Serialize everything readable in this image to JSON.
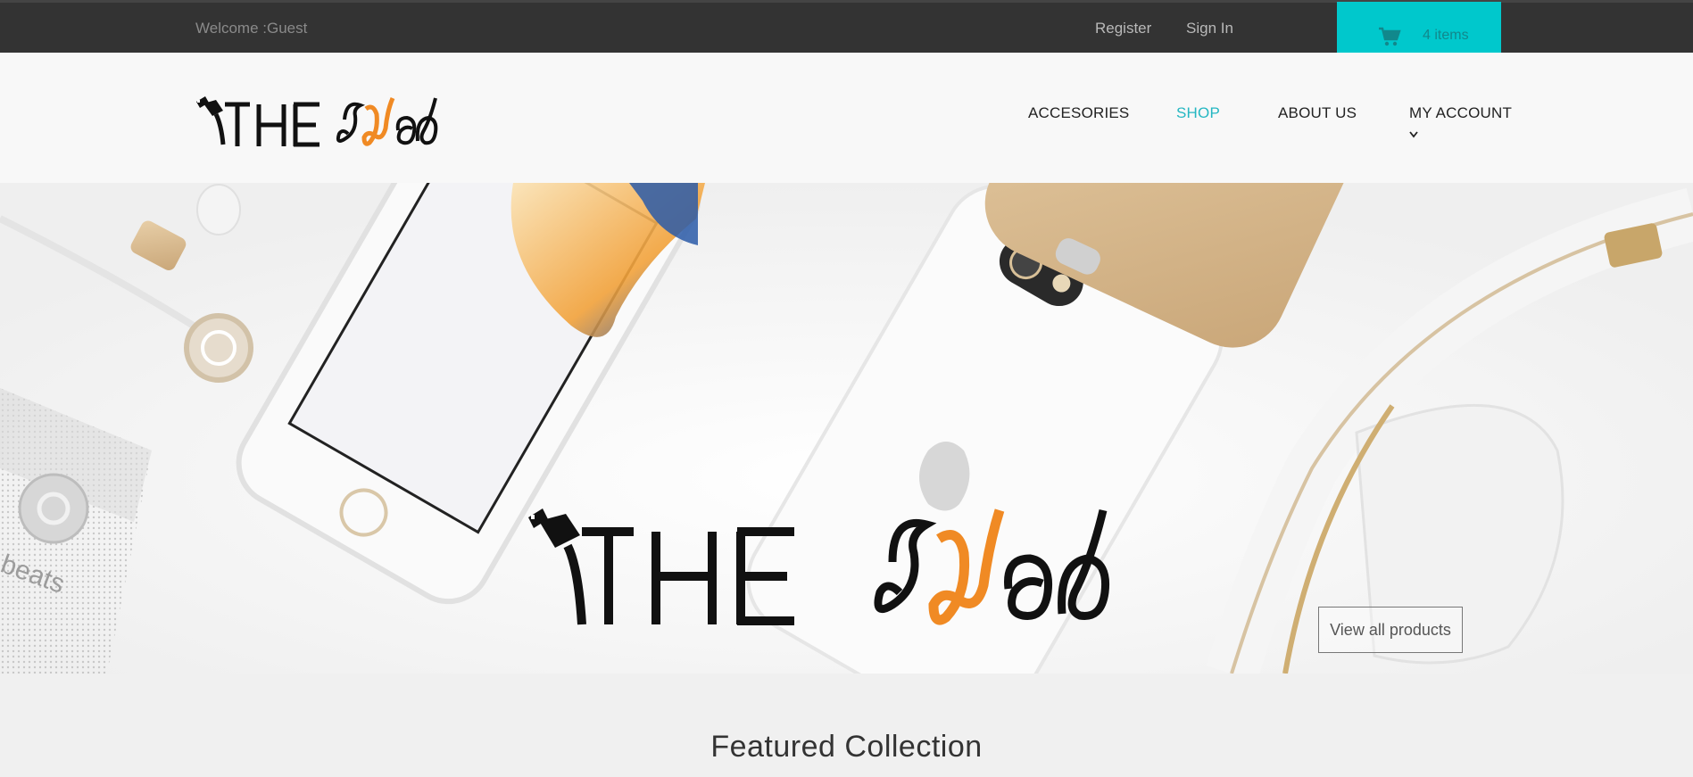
{
  "topbar": {
    "welcome": "Welcome :Guest",
    "register": "Register",
    "sign_in": "Sign In",
    "cart_count": "4 items",
    "cart_icon": "shopping-cart-icon",
    "cart_color": "#00c8cc"
  },
  "brand": {
    "word": "THE",
    "orange_accent": "#f08a24"
  },
  "nav": {
    "items": [
      {
        "label": "ACCESORIES"
      },
      {
        "label": "SHOP"
      },
      {
        "label": "ABOUT US"
      },
      {
        "label": "MY ACCOUNT"
      }
    ],
    "active_color": "#25b7c2"
  },
  "hero": {
    "cta": "View all products",
    "speaker_brand": "beats"
  },
  "featured": {
    "title": "Featured Collection"
  }
}
